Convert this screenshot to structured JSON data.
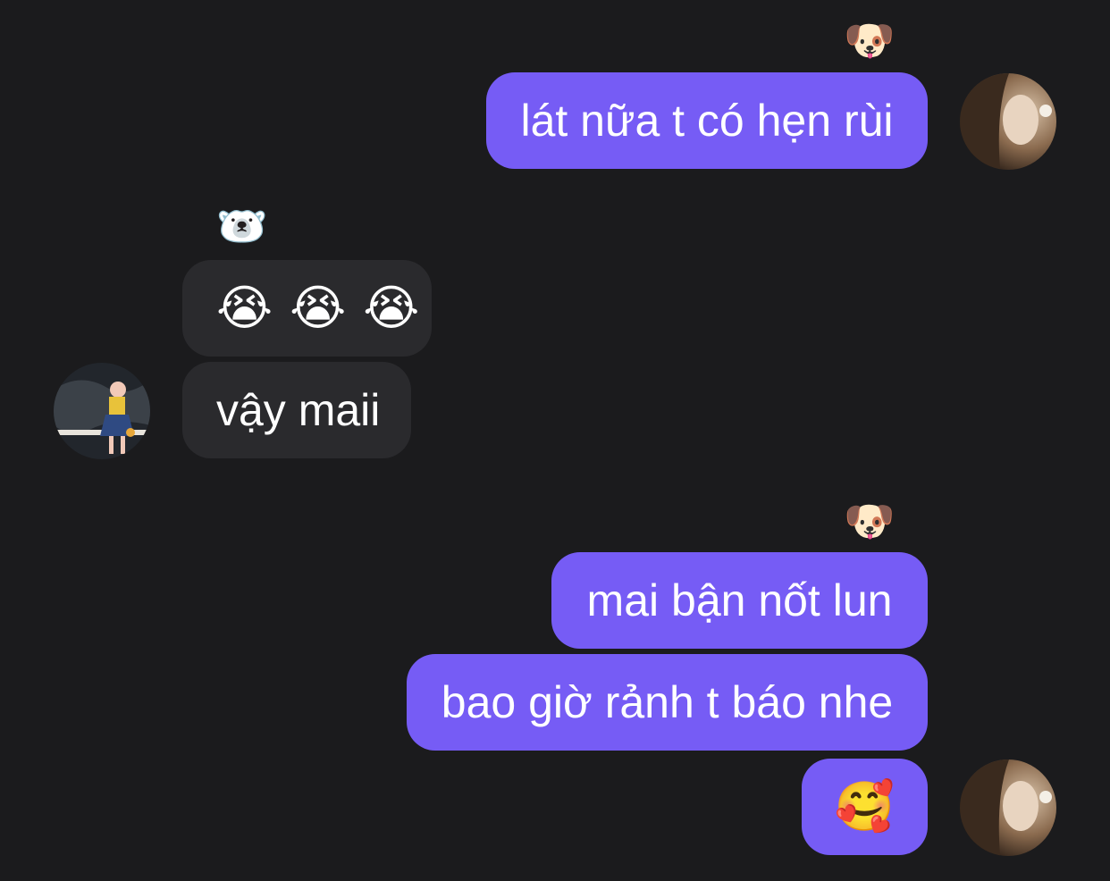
{
  "conversation": {
    "messages": [
      {
        "from": "me",
        "reaction_icon": "dog-face",
        "reaction": "🐶",
        "text": "lát nữa t có hẹn rùi"
      },
      {
        "from": "them",
        "reaction_icon": "polar-bear-face",
        "reaction": "🐻‍❄️",
        "text": "😭 😭 😭"
      },
      {
        "from": "them",
        "text": "vậy maii"
      },
      {
        "from": "me",
        "reaction_icon": "dog-face",
        "reaction": "🐶",
        "text": "mai bận nốt lun"
      },
      {
        "from": "me",
        "text": "bao giờ rảnh t báo nhe"
      },
      {
        "from": "me",
        "text": "🥰"
      }
    ]
  },
  "colors": {
    "background": "#1b1b1d",
    "sent_bubble": "#765cf5",
    "received_bubble": "#2a2a2d",
    "text": "#ffffff"
  }
}
